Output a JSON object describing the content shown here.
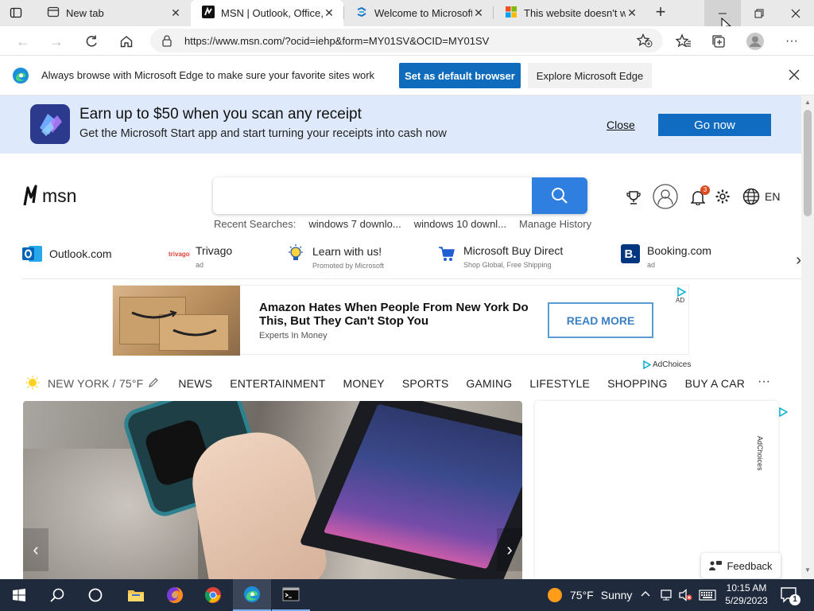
{
  "tabs": [
    {
      "title": "New tab",
      "icon": "new-tab-icon"
    },
    {
      "title": "MSN | Outlook, Office, Sk",
      "icon": "msn-icon"
    },
    {
      "title": "Welcome to Microsoft E",
      "icon": "edge-welcome-icon"
    },
    {
      "title": "This website doesn't wo",
      "icon": "microsoft-logo-icon"
    }
  ],
  "address": {
    "url": "https://www.msn.com/?ocid=iehp&form=MY01SV&OCID=MY01SV"
  },
  "infobar": {
    "message": "Always browse with Microsoft Edge to make sure your favorite sites work",
    "default_button": "Set as default browser",
    "explore_button": "Explore Microsoft Edge"
  },
  "promo": {
    "title": "Earn up to $50 when you scan any receipt",
    "subtitle": "Get the Microsoft Start app and start turning your receipts into cash now",
    "close_label": "Close",
    "go_label": "Go now"
  },
  "msn": {
    "logo_text": "msn",
    "search_placeholder": "",
    "recent_label": "Recent Searches:",
    "recent": [
      "windows 7 downlo...",
      "windows 10 downl..."
    ],
    "manage_history": "Manage History",
    "lang": "EN",
    "notif_count": "3"
  },
  "quicklinks": [
    {
      "name": "Outlook.com",
      "sub": ""
    },
    {
      "name": "Trivago",
      "sub": "ad"
    },
    {
      "name": "Learn with us!",
      "sub": "Promoted by Microsoft"
    },
    {
      "name": "Microsoft Buy Direct",
      "sub": "Shop Global, Free Shipping"
    },
    {
      "name": "Booking.com",
      "sub": "ad"
    }
  ],
  "ad": {
    "headline": "Amazon Hates When People From New York Do This, But They Can't Stop You",
    "source": "Experts In Money",
    "cta": "READ MORE",
    "adchoices": "AdChoices"
  },
  "nav": {
    "weather": "NEW YORK / 75°F",
    "items": [
      "NEWS",
      "ENTERTAINMENT",
      "MONEY",
      "SPORTS",
      "GAMING",
      "LIFESTYLE",
      "SHOPPING",
      "BUY A CAR"
    ],
    "more": "···"
  },
  "side_ad": {
    "label": "AdChoices"
  },
  "feedback": "Feedback",
  "taskbar": {
    "weather_temp": "75°F",
    "weather_cond": "Sunny",
    "time": "10:15 AM",
    "date": "5/29/2023",
    "notif_count": "1"
  },
  "colors": {
    "accent": "#0f6cbd",
    "go_button": "#0f6cc0",
    "promo_bg": "#deeafb",
    "taskbar": "#1f2a3d"
  }
}
